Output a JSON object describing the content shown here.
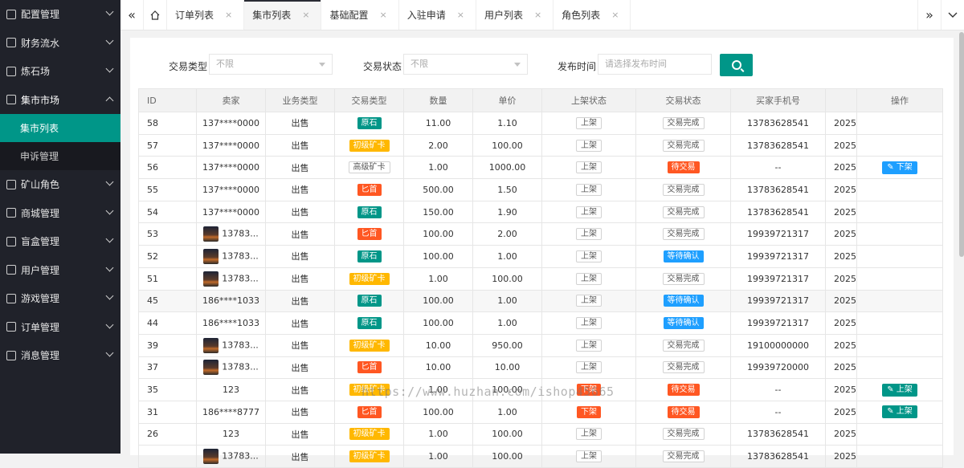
{
  "sidebar": {
    "items": [
      {
        "label": "配置管理",
        "icon": "sliders-icon"
      },
      {
        "label": "财务流水",
        "icon": "grid-icon"
      },
      {
        "label": "炼石场",
        "icon": "grid-icon"
      },
      {
        "label": "集市市场",
        "icon": "document-icon",
        "open": true
      },
      {
        "label": "矿山角色",
        "icon": "document-icon"
      },
      {
        "label": "商城管理",
        "icon": "bag-icon"
      },
      {
        "label": "盲盒管理",
        "icon": "gift-icon"
      },
      {
        "label": "用户管理",
        "icon": "user-icon"
      },
      {
        "label": "游戏管理",
        "icon": "gamepad-icon"
      },
      {
        "label": "订单管理",
        "icon": "document-icon"
      },
      {
        "label": "消息管理",
        "icon": "tag-icon"
      }
    ],
    "sub_items": [
      {
        "label": "集市列表",
        "active": true
      },
      {
        "label": "申诉管理",
        "active": false
      }
    ]
  },
  "tabs": [
    {
      "label": "订单列表",
      "active": false
    },
    {
      "label": "集市列表",
      "active": true
    },
    {
      "label": "基础配置",
      "active": false
    },
    {
      "label": "入驻申请",
      "active": false
    },
    {
      "label": "用户列表",
      "active": false
    },
    {
      "label": "角色列表",
      "active": false
    }
  ],
  "tab_close": "×",
  "filters": {
    "trade_type_label": "交易类型",
    "trade_type_value": "不限",
    "trade_status_label": "交易状态",
    "trade_status_value": "不限",
    "publish_time_label": "发布时间",
    "publish_time_placeholder": "请选择发布时间"
  },
  "table": {
    "columns": [
      "ID",
      "卖家",
      "业务类型",
      "交易类型",
      "数量",
      "单价",
      "上架状态",
      "交易状态",
      "买家手机号",
      "",
      "操作"
    ],
    "rows": [
      {
        "id": "58",
        "seller": "137****0000",
        "avatar": false,
        "biz": "出售",
        "type": "原石",
        "type_color": "green",
        "qty": "11.00",
        "price": "1.10",
        "shelf": "上架",
        "shelf_style": "plain",
        "status": "交易完成",
        "status_style": "plain",
        "phone": "13783628541",
        "date": "2025",
        "op": ""
      },
      {
        "id": "57",
        "seller": "137****0000",
        "avatar": false,
        "biz": "出售",
        "type": "初级矿卡",
        "type_color": "orange",
        "qty": "2.00",
        "price": "100.00",
        "shelf": "上架",
        "shelf_style": "plain",
        "status": "交易完成",
        "status_style": "plain",
        "phone": "13783628541",
        "date": "2025",
        "op": ""
      },
      {
        "id": "56",
        "seller": "137****0000",
        "avatar": false,
        "biz": "出售",
        "type": "高级矿卡",
        "type_color": "plain",
        "qty": "1.00",
        "price": "1000.00",
        "shelf": "上架",
        "shelf_style": "plain",
        "status": "待交易",
        "status_style": "red",
        "phone": "--",
        "date": "2025",
        "op": "下架",
        "op_style": "blue"
      },
      {
        "id": "55",
        "seller": "137****0000",
        "avatar": false,
        "biz": "出售",
        "type": "匕首",
        "type_color": "red",
        "qty": "500.00",
        "price": "1.50",
        "shelf": "上架",
        "shelf_style": "plain",
        "status": "交易完成",
        "status_style": "plain",
        "phone": "13783628541",
        "date": "2025",
        "op": ""
      },
      {
        "id": "54",
        "seller": "137****0000",
        "avatar": false,
        "biz": "出售",
        "type": "原石",
        "type_color": "green",
        "qty": "150.00",
        "price": "1.90",
        "shelf": "上架",
        "shelf_style": "plain",
        "status": "交易完成",
        "status_style": "plain",
        "phone": "13783628541",
        "date": "2025",
        "op": ""
      },
      {
        "id": "53",
        "seller": "13783...",
        "avatar": true,
        "biz": "出售",
        "type": "匕首",
        "type_color": "red",
        "qty": "100.00",
        "price": "2.00",
        "shelf": "上架",
        "shelf_style": "plain",
        "status": "交易完成",
        "status_style": "plain",
        "phone": "19939721317",
        "date": "2025",
        "op": ""
      },
      {
        "id": "52",
        "seller": "13783...",
        "avatar": true,
        "biz": "出售",
        "type": "原石",
        "type_color": "green",
        "qty": "100.00",
        "price": "1.00",
        "shelf": "上架",
        "shelf_style": "plain",
        "status": "等待确认",
        "status_style": "blue",
        "phone": "19939721317",
        "date": "2025",
        "op": ""
      },
      {
        "id": "51",
        "seller": "13783...",
        "avatar": true,
        "biz": "出售",
        "type": "初级矿卡",
        "type_color": "orange",
        "qty": "1.00",
        "price": "100.00",
        "shelf": "上架",
        "shelf_style": "plain",
        "status": "交易完成",
        "status_style": "plain",
        "phone": "19939721317",
        "date": "2025",
        "op": ""
      },
      {
        "id": "45",
        "seller": "186****1033",
        "avatar": false,
        "biz": "出售",
        "type": "原石",
        "type_color": "green",
        "qty": "100.00",
        "price": "1.00",
        "shelf": "上架",
        "shelf_style": "plain",
        "status": "等待确认",
        "status_style": "blue",
        "phone": "19939721317",
        "date": "2025",
        "op": "",
        "hl": true
      },
      {
        "id": "44",
        "seller": "186****1033",
        "avatar": false,
        "biz": "出售",
        "type": "原石",
        "type_color": "green",
        "qty": "100.00",
        "price": "1.00",
        "shelf": "上架",
        "shelf_style": "plain",
        "status": "等待确认",
        "status_style": "blue",
        "phone": "19939721317",
        "date": "2025",
        "op": ""
      },
      {
        "id": "39",
        "seller": "13783...",
        "avatar": true,
        "biz": "出售",
        "type": "初级矿卡",
        "type_color": "orange",
        "qty": "10.00",
        "price": "950.00",
        "shelf": "上架",
        "shelf_style": "plain",
        "status": "交易完成",
        "status_style": "plain",
        "phone": "19100000000",
        "date": "2025",
        "op": ""
      },
      {
        "id": "37",
        "seller": "13783...",
        "avatar": true,
        "biz": "出售",
        "type": "匕首",
        "type_color": "red",
        "qty": "10.00",
        "price": "10.00",
        "shelf": "上架",
        "shelf_style": "plain",
        "status": "交易完成",
        "status_style": "plain",
        "phone": "19939720000",
        "date": "2025",
        "op": ""
      },
      {
        "id": "35",
        "seller": "123",
        "avatar": false,
        "biz": "出售",
        "type": "初级矿卡",
        "type_color": "orange",
        "qty": "1.00",
        "price": "100.00",
        "shelf": "下架",
        "shelf_style": "red",
        "status": "待交易",
        "status_style": "red",
        "phone": "--",
        "date": "2025",
        "op": "上架",
        "op_style": "green"
      },
      {
        "id": "31",
        "seller": "186****8777",
        "avatar": false,
        "biz": "出售",
        "type": "匕首",
        "type_color": "red",
        "qty": "100.00",
        "price": "1.00",
        "shelf": "下架",
        "shelf_style": "red",
        "status": "待交易",
        "status_style": "red",
        "phone": "--",
        "date": "2025",
        "op": "上架",
        "op_style": "green"
      },
      {
        "id": "26",
        "seller": "123",
        "avatar": false,
        "biz": "出售",
        "type": "初级矿卡",
        "type_color": "orange",
        "qty": "1.00",
        "price": "100.00",
        "shelf": "上架",
        "shelf_style": "plain",
        "status": "交易完成",
        "status_style": "plain",
        "phone": "13783628541",
        "date": "2025",
        "op": ""
      },
      {
        "id": "",
        "seller": "13783...",
        "avatar": true,
        "biz": "出售",
        "type": "初级矿卡",
        "type_color": "orange",
        "qty": "1.00",
        "price": "100.00",
        "shelf": "上架",
        "shelf_style": "plain",
        "status": "交易完成",
        "status_style": "plain",
        "phone": "13783628541",
        "date": "2025",
        "op": ""
      }
    ]
  },
  "watermark": "https://www.huzhan.com/ishop45665",
  "colors": {
    "accent": "#009688",
    "sidebar_bg": "#20222a",
    "red": "#ff5722",
    "orange": "#ffb800",
    "blue": "#1e9fff"
  }
}
